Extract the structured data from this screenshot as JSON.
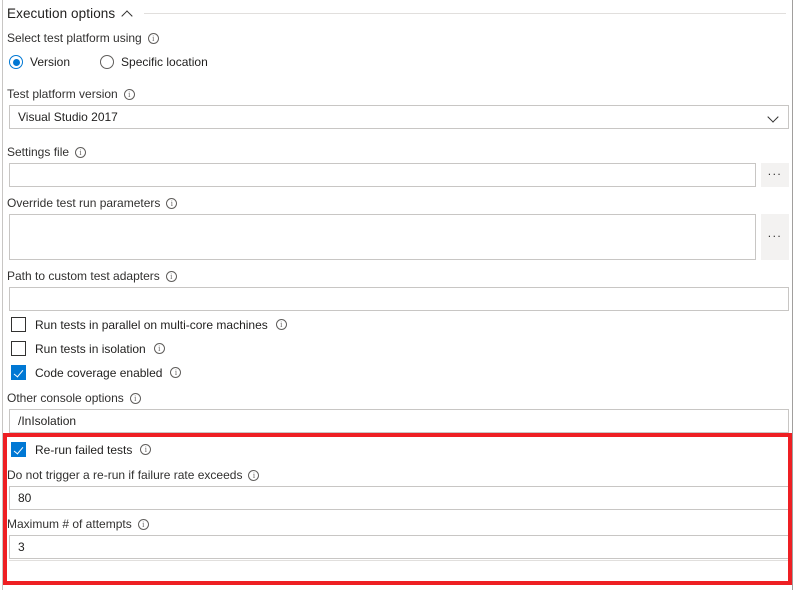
{
  "section": {
    "title": "Execution options",
    "collapse_icon": "chevron-up-icon"
  },
  "platform_select": {
    "label": "Select test platform using",
    "info_icon": "info-icon",
    "options": [
      {
        "label": "Version",
        "selected": true
      },
      {
        "label": "Specific location",
        "selected": false
      }
    ]
  },
  "test_platform_version": {
    "label": "Test platform version",
    "value": "Visual Studio 2017",
    "chevron_icon": "chevron-down-icon"
  },
  "settings_file": {
    "label": "Settings file",
    "value": "",
    "browse_label": "..."
  },
  "override_params": {
    "label": "Override test run parameters",
    "value": "",
    "browse_label": "..."
  },
  "custom_adapters": {
    "label": "Path to custom test adapters",
    "value": ""
  },
  "checkboxes": [
    {
      "label": "Run tests in parallel on multi-core machines",
      "checked": false
    },
    {
      "label": "Run tests in isolation",
      "checked": false
    },
    {
      "label": "Code coverage enabled",
      "checked": true
    }
  ],
  "other_console_options": {
    "label": "Other console options",
    "value": "/InIsolation"
  },
  "rerun": {
    "checkbox_label": "Re-run failed tests",
    "checked": true,
    "failure_rate": {
      "label": "Do not trigger a re-run if failure rate exceeds",
      "value": "80"
    },
    "max_attempts": {
      "label": "Maximum # of attempts",
      "value": "3"
    }
  },
  "colors": {
    "accent": "#0078d4",
    "highlight": "#ee1f23",
    "border": "#c8c6c4",
    "text": "#201f1e"
  }
}
